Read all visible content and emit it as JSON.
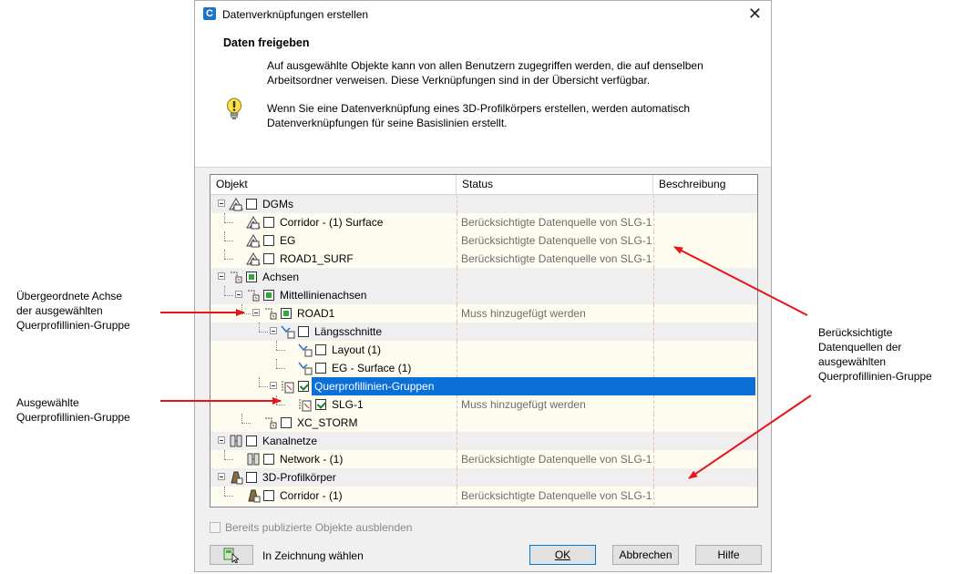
{
  "window": {
    "title": "Datenverknüpfungen erstellen",
    "app_icon_letter": "C"
  },
  "header": {
    "section_title": "Daten freigeben",
    "description": "Auf ausgewählte Objekte kann von allen Benutzern zugegriffen werden, die auf denselben Arbeitsordner verweisen. Diese Verknüpfungen sind in der Übersicht verfügbar.",
    "hint": "Wenn Sie eine Datenverknüpfung eines 3D-Profilkörpers erstellen, werden automatisch Datenverknüpfungen für seine Basislinien erstellt."
  },
  "tree": {
    "columns": [
      "Objekt",
      "Status",
      "Beschreibung"
    ],
    "rows": [
      {
        "label": "DGMs",
        "status": "",
        "level": 0,
        "kind": "group",
        "check": "none"
      },
      {
        "label": "Corridor - (1) Surface",
        "status": "Berücksichtigte Datenquelle von SLG-1",
        "level": 1,
        "kind": "leaf",
        "check": "none"
      },
      {
        "label": "EG",
        "status": "Berücksichtigte Datenquelle von SLG-1",
        "level": 1,
        "kind": "leaf",
        "check": "none"
      },
      {
        "label": "ROAD1_SURF",
        "status": "Berücksichtigte Datenquelle von SLG-1",
        "level": 1,
        "kind": "leaf",
        "check": "none"
      },
      {
        "label": "Achsen",
        "status": "",
        "level": 0,
        "kind": "group",
        "check": "partial"
      },
      {
        "label": "Mittellinienachsen",
        "status": "",
        "level": 1,
        "kind": "group",
        "check": "partial"
      },
      {
        "label": "ROAD1",
        "status": "Muss hinzugefügt werden",
        "level": 2,
        "kind": "leaf",
        "check": "partial"
      },
      {
        "label": "Längsschnitte",
        "status": "",
        "level": 3,
        "kind": "group",
        "check": "none"
      },
      {
        "label": "Layout (1)",
        "status": "",
        "level": 4,
        "kind": "leaf",
        "check": "none"
      },
      {
        "label": "EG - Surface (1)",
        "status": "",
        "level": 4,
        "kind": "leaf",
        "check": "none"
      },
      {
        "label": "Querprofillinien-Gruppen",
        "status": "",
        "level": 3,
        "kind": "selected",
        "check": "checked"
      },
      {
        "label": "SLG-1",
        "status": "Muss hinzugefügt werden",
        "level": 4,
        "kind": "leaf",
        "check": "checked"
      },
      {
        "label": "XC_STORM",
        "status": "",
        "level": 2,
        "kind": "leaf",
        "check": "none"
      },
      {
        "label": "Kanalnetze",
        "status": "",
        "level": 0,
        "kind": "group",
        "check": "none"
      },
      {
        "label": "Network - (1)",
        "status": "Berücksichtigte Datenquelle von SLG-1",
        "level": 1,
        "kind": "leaf",
        "check": "none"
      },
      {
        "label": "3D-Profilkörper",
        "status": "",
        "level": 0,
        "kind": "group",
        "check": "none"
      },
      {
        "label": "Corridor - (1)",
        "status": "Berücksichtigte Datenquelle von SLG-1",
        "level": 1,
        "kind": "leaf",
        "check": "none"
      }
    ]
  },
  "footer": {
    "hide_published_label": "Bereits publizierte Objekte ausblenden",
    "pick_in_drawing_label": "In Zeichnung wählen",
    "ok_label": "OK",
    "cancel_label": "Abbrechen",
    "help_label": "Hilfe"
  },
  "annotations": {
    "parent_alignment": "Übergeordnete Achse\nder ausgewählten\nQuerprofillinien-Gruppe",
    "selected_group": "Ausgewählte\nQuerprofillinien-Gruppe",
    "considered_sources": "Berücksichtigte\nDatenquellen der\nausgewählten\nQuerprofillinien-Gruppe"
  },
  "colors": {
    "selection": "#0a6fd7",
    "arrow": "#e8141a",
    "leaf_row": "#fdfcee",
    "group_row": "#efefef"
  }
}
